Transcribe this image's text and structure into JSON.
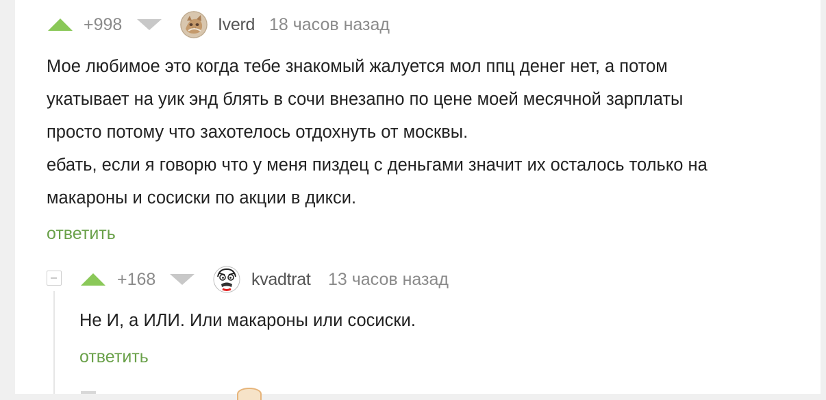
{
  "comments": [
    {
      "rating": "+998",
      "username": "Iverd",
      "time": "18 часов назад",
      "text_lines": [
        "Мое любимое это когда тебе знакомый жалуется мол ппц денег нет, а потом",
        "укатывает на уик энд блять в сочи внезапно по цене моей месячной зарплаты",
        "просто потому что захотелось отдохнуть от москвы.",
        "ебать, если я говорю что у меня пиздец с деньгами значит их осталось только на",
        "макароны и сосиски по акции в дикси."
      ],
      "reply_label": "ответить"
    },
    {
      "rating": "+168",
      "username": "kvadtrat",
      "time": "13 часов назад",
      "text_lines": [
        "Не И, а ИЛИ. Или макароны или сосиски."
      ],
      "reply_label": "ответить"
    }
  ],
  "colors": {
    "accent_green": "#8ac858",
    "reply_green": "#6aa14a",
    "muted_gray": "#8a8a8a",
    "downvote_gray": "#c8c8c8"
  }
}
